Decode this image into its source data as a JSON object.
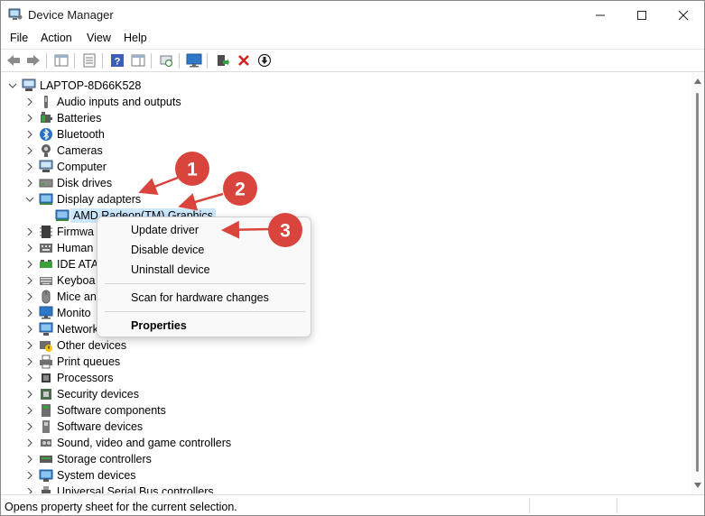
{
  "window": {
    "title": "Device Manager"
  },
  "menu": [
    "File",
    "Action",
    "View",
    "Help"
  ],
  "toolbar": {
    "icons": [
      "back-arrow-icon",
      "forward-arrow-icon",
      "show-hide-tree-icon",
      "properties-sheet-icon",
      "help-icon",
      "action-pane-icon",
      "scan-hardware-icon",
      "monitor-icon",
      "update-driver-icon",
      "uninstall-device-icon",
      "disable-device-icon"
    ]
  },
  "tree": {
    "root": "LAPTOP-8D66K528",
    "categories": [
      "Audio inputs and outputs",
      "Batteries",
      "Bluetooth",
      "Cameras",
      "Computer",
      "Disk drives",
      "Display adapters",
      "Firmware",
      "Human Interface Devices",
      "IDE ATA/ATAPI controllers",
      "Keyboards",
      "Mice and other pointing devices",
      "Monitors",
      "Network adapters",
      "Other devices",
      "Print queues",
      "Processors",
      "Security devices",
      "Software components",
      "Software devices",
      "Sound, video and game controllers",
      "Storage controllers",
      "System devices",
      "Universal Serial Bus controllers"
    ],
    "visible_labels": {
      "firmware": "Firmwa",
      "human": "Human",
      "ide": "IDE ATA",
      "keyboards": "Keyboa",
      "mice": "Mice an",
      "monitors": "Monito",
      "network": "Network"
    },
    "expanded_child": "AMD Radeon(TM) Graphics"
  },
  "context_menu": {
    "update": "Update driver",
    "disable": "Disable device",
    "uninstall": "Uninstall device",
    "scan": "Scan for hardware changes",
    "properties": "Properties"
  },
  "annotations": [
    "1",
    "2",
    "3"
  ],
  "colors": {
    "annotation_red": "#d9453c",
    "selection": "#cce8ff"
  },
  "status": {
    "text": "Opens property sheet for the current selection."
  }
}
